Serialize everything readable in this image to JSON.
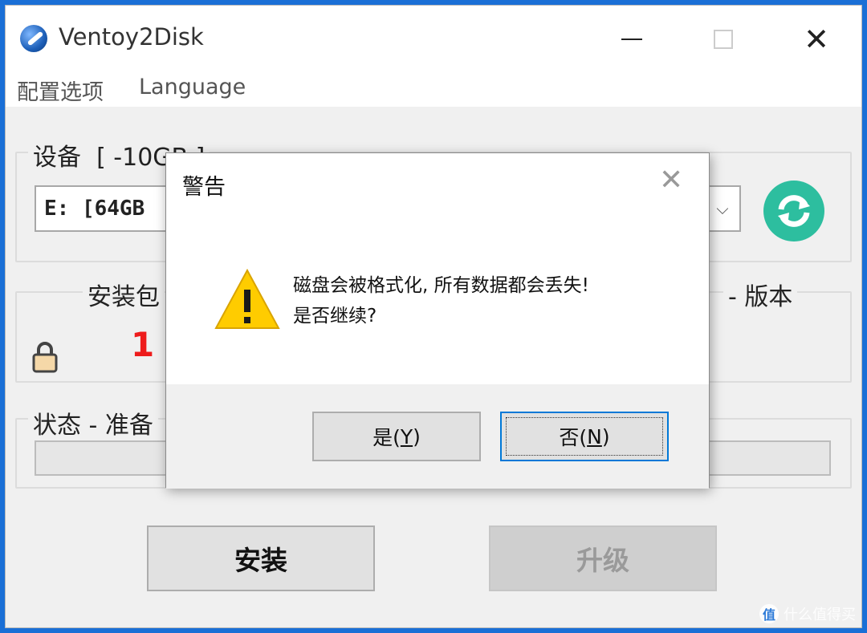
{
  "window": {
    "title": "Ventoy2Disk",
    "menu": [
      "配置选项",
      "Language"
    ]
  },
  "device": {
    "label": "设备  [ -10GB ]",
    "selected": "E: [64GB"
  },
  "package": {
    "label": "安装包",
    "version_label": "- 版本",
    "marker": "1"
  },
  "status": {
    "label": "状态 - 准备"
  },
  "buttons": {
    "install": "安装",
    "upgrade": "升级"
  },
  "dialog": {
    "title": "警告",
    "message_line1": "磁盘会被格式化, 所有数据都会丢失!",
    "message_line2": "是否继续?",
    "yes_text": "是(",
    "yes_key": "Y",
    "yes_end": ")",
    "no_text": "否(",
    "no_key": "N",
    "no_end": ")"
  },
  "watermark": {
    "badge": "值",
    "text": "什么值得买"
  },
  "colors": {
    "accent": "#0078d7",
    "refresh": "#2dbe9f",
    "marker": "#ee1c1c",
    "warning": "#ffcc00"
  }
}
